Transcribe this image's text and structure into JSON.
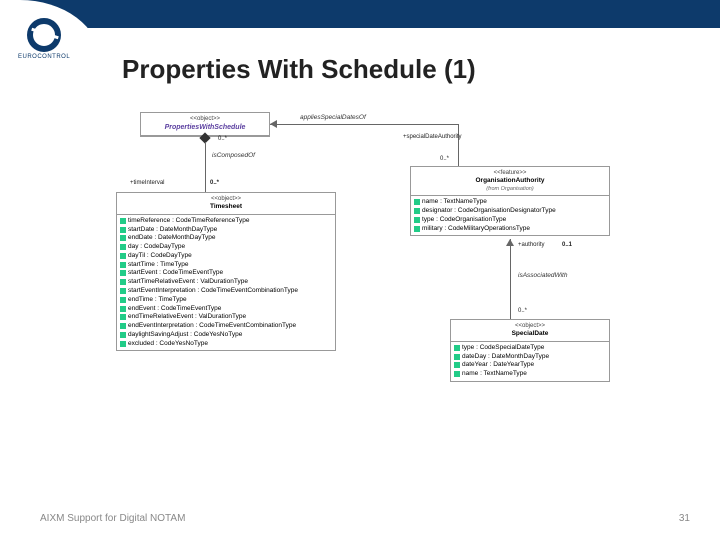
{
  "brand": {
    "name": "EUROCONTROL"
  },
  "title": "Properties With Schedule (1)",
  "footer": {
    "left": "AIXM Support for Digital NOTAM",
    "page": "31"
  },
  "boxes": {
    "pws": {
      "stereo": "<<object>>",
      "name": "PropertiesWithSchedule"
    },
    "timesheet": {
      "stereo": "<<object>>",
      "name": "Timesheet",
      "attrs": [
        "timeReference : CodeTimeReferenceType",
        "startDate : DateMonthDayType",
        "endDate : DateMonthDayType",
        "day : CodeDayType",
        "dayTil : CodeDayType",
        "startTime : TimeType",
        "startEvent : CodeTimeEventType",
        "startTimeRelativeEvent : ValDurationType",
        "startEventInterpretation : CodeTimeEventCombinationType",
        "endTime : TimeType",
        "endEvent : CodeTimeEventType",
        "endTimeRelativeEvent : ValDurationType",
        "endEventInterpretation : CodeTimeEventCombinationType",
        "daylightSavingAdjust : CodeYesNoType",
        "excluded : CodeYesNoType"
      ]
    },
    "org": {
      "stereo": "<<feature>>",
      "name": "OrganisationAuthority",
      "from": "(from Organisation)",
      "attrs": [
        "name : TextNameType",
        "designator : CodeOrganisationDesignatorType",
        "type : CodeOrganisationType",
        "military : CodeMilitaryOperationsType"
      ]
    },
    "special": {
      "stereo": "<<object>>",
      "name": "SpecialDate",
      "attrs": [
        "type : CodeSpecialDateType",
        "dateDay : DateMonthDayType",
        "dateYear : DateYearType",
        "name : TextNameType"
      ]
    }
  },
  "rel": {
    "appliesSpecialDatesOf": "appliesSpecialDatesOf",
    "specialDateAuthority": "+specialDateAuthority",
    "isComposedOf": "isComposedOf",
    "timeInterval": "+timeInterval",
    "isAssociatedWith": "isAssociatedWith",
    "authority": "+authority",
    "m0s": "0..*",
    "m01": "0..1"
  }
}
